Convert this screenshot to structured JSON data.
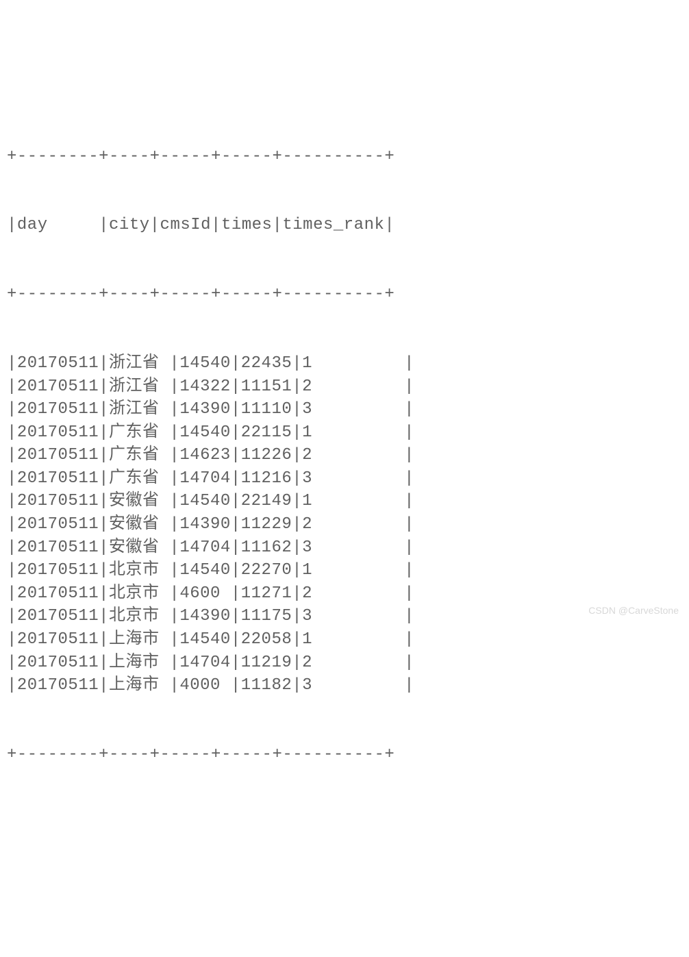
{
  "separator_top": "+--------+----+-----+-----+----------+",
  "separator_mid": "+--------+----+-----+-----+----------+",
  "separator_bot": "+--------+----+-----+-----+----------+",
  "headers": {
    "day": "day",
    "city": "city",
    "cmsId": "cmsId",
    "times": "times",
    "times_rank": "times_rank"
  },
  "header_line": "|day     |city|cmsId|times|times_rank|",
  "rows": [
    {
      "day": "20170511",
      "city": "浙江省 ",
      "cmsId": "14540",
      "times": "22435",
      "times_rank": "1         "
    },
    {
      "day": "20170511",
      "city": "浙江省 ",
      "cmsId": "14322",
      "times": "11151",
      "times_rank": "2         "
    },
    {
      "day": "20170511",
      "city": "浙江省 ",
      "cmsId": "14390",
      "times": "11110",
      "times_rank": "3         "
    },
    {
      "day": "20170511",
      "city": "广东省 ",
      "cmsId": "14540",
      "times": "22115",
      "times_rank": "1         "
    },
    {
      "day": "20170511",
      "city": "广东省 ",
      "cmsId": "14623",
      "times": "11226",
      "times_rank": "2         "
    },
    {
      "day": "20170511",
      "city": "广东省 ",
      "cmsId": "14704",
      "times": "11216",
      "times_rank": "3         "
    },
    {
      "day": "20170511",
      "city": "安徽省 ",
      "cmsId": "14540",
      "times": "22149",
      "times_rank": "1         "
    },
    {
      "day": "20170511",
      "city": "安徽省 ",
      "cmsId": "14390",
      "times": "11229",
      "times_rank": "2         "
    },
    {
      "day": "20170511",
      "city": "安徽省 ",
      "cmsId": "14704",
      "times": "11162",
      "times_rank": "3         "
    },
    {
      "day": "20170511",
      "city": "北京市 ",
      "cmsId": "14540",
      "times": "22270",
      "times_rank": "1         "
    },
    {
      "day": "20170511",
      "city": "北京市 ",
      "cmsId": "4600 ",
      "times": "11271",
      "times_rank": "2         "
    },
    {
      "day": "20170511",
      "city": "北京市 ",
      "cmsId": "14390",
      "times": "11175",
      "times_rank": "3         "
    },
    {
      "day": "20170511",
      "city": "上海市 ",
      "cmsId": "14540",
      "times": "22058",
      "times_rank": "1         "
    },
    {
      "day": "20170511",
      "city": "上海市 ",
      "cmsId": "14704",
      "times": "11219",
      "times_rank": "2         "
    },
    {
      "day": "20170511",
      "city": "上海市 ",
      "cmsId": "4000 ",
      "times": "11182",
      "times_rank": "3         "
    }
  ],
  "watermark": "CSDN @CarveStone"
}
